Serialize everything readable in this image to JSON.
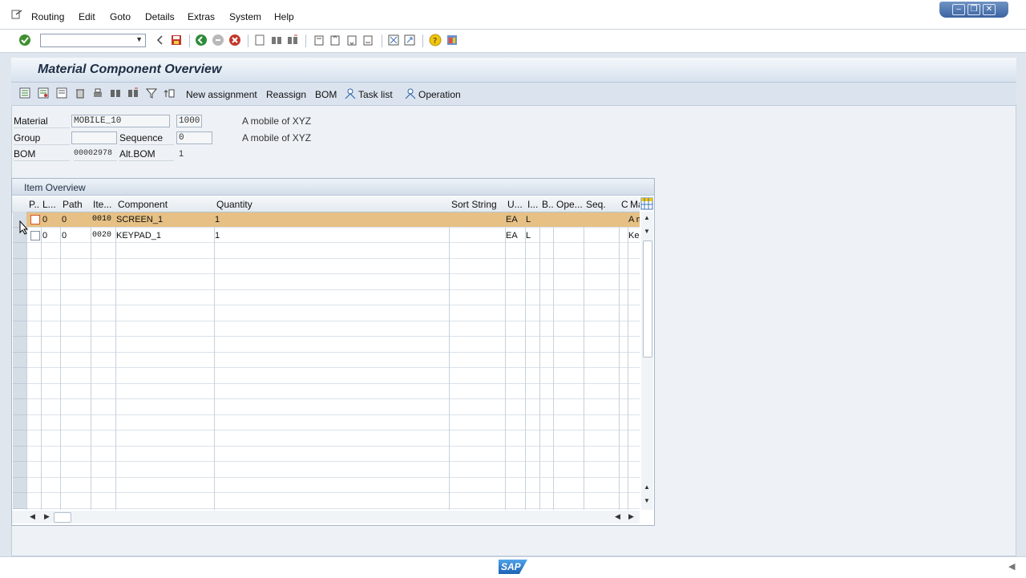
{
  "menubar": {
    "items": [
      "Routing",
      "Edit",
      "Goto",
      "Details",
      "Extras",
      "System",
      "Help"
    ]
  },
  "screen": {
    "title": "Material Component Overview"
  },
  "app_toolbar": {
    "buttons": [
      "New assignment",
      "Reassign",
      "BOM",
      "Task list",
      "Operation"
    ]
  },
  "header": {
    "material_label": "Material",
    "material_value": "MOBILE_10",
    "plant_value": "1000",
    "material_desc": "A mobile of XYZ",
    "group_label": "Group",
    "group_value": "",
    "sequence_label": "Sequence",
    "sequence_value": "0",
    "group_desc": "A mobile of XYZ",
    "bom_label": "BOM",
    "bom_value": "00002978",
    "altbom_label": "Alt.BOM",
    "altbom_value": "1"
  },
  "table": {
    "title": "Item Overview",
    "columns": [
      "P..",
      "L...",
      "Path",
      "Ite...",
      "Component",
      "Quantity",
      "Sort String",
      "U...",
      "I...",
      "B..",
      "Ope...",
      "Seq.",
      "C",
      "Ma"
    ],
    "rows": [
      {
        "level": "0",
        "path": "0",
        "item": "0010",
        "component": "SCREEN_1",
        "quantity": "1",
        "sort": "",
        "unit": "EA",
        "icat": "L",
        "b": "",
        "op": "",
        "seq": "",
        "c": "",
        "ma": "A m"
      },
      {
        "level": "0",
        "path": "0",
        "item": "0020",
        "component": "KEYPAD_1",
        "quantity": "1",
        "sort": "",
        "unit": "EA",
        "icat": "L",
        "b": "",
        "op": "",
        "seq": "",
        "c": "",
        "ma": "Ke"
      }
    ]
  },
  "status": {
    "logo_text": "SAP"
  },
  "colors": {
    "selected_row": "#e6c084",
    "accent": "#2a5ea8"
  }
}
